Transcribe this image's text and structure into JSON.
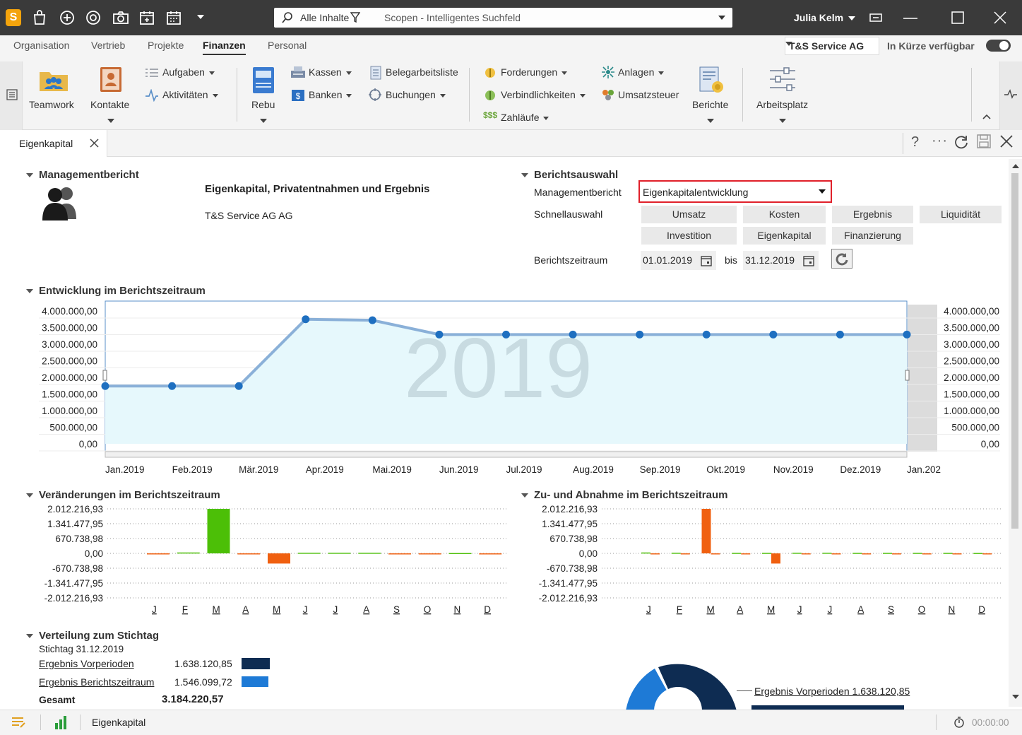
{
  "titlebar": {
    "search_scope": "Alle Inhalte",
    "search_placeholder": "Scopen - Intelligentes Suchfeld",
    "user": "Julia Kelm"
  },
  "menu": {
    "tabs": [
      "Organisation",
      "Vertrieb",
      "Projekte",
      "Finanzen",
      "Personal"
    ],
    "active": "Finanzen",
    "company": "T&S Service AG",
    "availability": "In Kürze verfügbar"
  },
  "ribbon": {
    "teamwork": "Teamwork",
    "kontakte": "Kontakte",
    "aufgaben": "Aufgaben",
    "aktivitaeten": "Aktivitäten",
    "rebu": "Rebu",
    "kassen": "Kassen",
    "banken": "Banken",
    "belegarbeitsliste": "Belegarbeitsliste",
    "buchungen": "Buchungen",
    "forderungen": "Forderungen",
    "verbindlichkeiten": "Verbindlichkeiten",
    "zahllaeufe": "Zahläufe",
    "anlagen": "Anlagen",
    "umsatzsteuer": "Umsatzsteuer",
    "berichte": "Berichte",
    "arbeitsplatz": "Arbeitsplatz"
  },
  "doc_tab": "Eigenkapital",
  "mgmt": {
    "section": "Managementbericht",
    "title": "Eigenkapital, Privatentnahmen und Ergebnis",
    "company": "T&S Service AG AG"
  },
  "auswahl": {
    "section": "Berichtsauswahl",
    "report_label": "Managementbericht",
    "report_value": "Eigenkapitalentwicklung",
    "quick_label": "Schnellauswahl",
    "quick": [
      "Umsatz",
      "Kosten",
      "Ergebnis",
      "Liquidität",
      "Investition",
      "Eigenkapital",
      "Finanzierung"
    ],
    "period_label": "Berichtszeitraum",
    "from": "01.01.2019",
    "bis": "bis",
    "to": "31.12.2019"
  },
  "entwicklung": {
    "section": "Entwicklung im Berichtszeitraum",
    "watermark": "2019"
  },
  "chart_data": [
    {
      "type": "area",
      "x": [
        "Jan.2019",
        "Feb.2019",
        "Mär.2019",
        "Apr.2019",
        "Mai.2019",
        "Jun.2019",
        "Jul.2019",
        "Aug.2019",
        "Sep.2019",
        "Okt.2019",
        "Nov.2019",
        "Dez.2019",
        "Jan.202"
      ],
      "values": [
        1740000,
        1740000,
        1740000,
        3750000,
        3720000,
        3290000,
        3290000,
        3290000,
        3290000,
        3290000,
        3290000,
        3290000,
        3290000
      ],
      "ylim": [
        0,
        4000000
      ],
      "yticks": [
        "4.000.000,00",
        "3.500.000,00",
        "3.000.000,00",
        "2.500.000,00",
        "2.000.000,00",
        "1.500.000,00",
        "1.000.000,00",
        "500.000,00",
        "0,00"
      ]
    },
    {
      "type": "bar",
      "title": "Veränderungen im Berichtszeitraum",
      "categories": [
        "J",
        "F",
        "M",
        "A",
        "M",
        "J",
        "J",
        "A",
        "S",
        "O",
        "N",
        "D"
      ],
      "values": [
        -20000,
        40000,
        2012216.93,
        -20000,
        -460000,
        30000,
        30000,
        30000,
        -15000,
        -15000,
        15000,
        -15000
      ],
      "ylim": [
        -2012216.93,
        2012216.93
      ],
      "yticks": [
        "2.012.216,93",
        "1.341.477,95",
        "670.738,98",
        "0,00",
        "-670.738,98",
        "-1.341.477,95",
        "-2.012.216,93"
      ]
    },
    {
      "type": "bar",
      "title": "Zu- und Abnahme im Berichtszeitraum",
      "categories": [
        "J",
        "F",
        "M",
        "A",
        "M",
        "J",
        "J",
        "A",
        "S",
        "O",
        "N",
        "D"
      ],
      "series": [
        {
          "values": [
            40000,
            30000,
            2012216.93,
            25000,
            25000,
            30000,
            30000,
            25000,
            25000,
            25000,
            25000,
            20000
          ]
        },
        {
          "values": [
            -20000,
            -10000,
            0,
            -20000,
            -460000,
            -15000,
            -15000,
            -15000,
            -15000,
            -15000,
            -15000,
            -15000
          ]
        }
      ],
      "ylim": [
        -2012216.93,
        2012216.93
      ],
      "yticks": [
        "2.012.216,93",
        "1.341.477,95",
        "670.738,98",
        "0,00",
        "-670.738,98",
        "-1.341.477,95",
        "-2.012.216,93"
      ]
    },
    {
      "type": "pie",
      "categories": [
        "Ergebnis Vorperioden",
        "Ergebnis Berichtszeitraum"
      ],
      "values": [
        1638120.85,
        1546099.72
      ]
    }
  ],
  "changes": {
    "section": "Veränderungen im Berichtszeitraum"
  },
  "zuab": {
    "section": "Zu- und Abnahme im Berichtszeitraum"
  },
  "verteilung": {
    "section": "Verteilung zum Stichtag",
    "stichtag": "Stichtag 31.12.2019",
    "rows": [
      {
        "label": "Ergebnis Vorperioden",
        "value": "1.638.120,85"
      },
      {
        "label": "Ergebnis Berichtszeitraum",
        "value": "1.546.099,72"
      }
    ],
    "total_label": "Gesamt",
    "total_value": "3.184.220,57",
    "pie_legend": "Ergebnis Vorperioden 1.638.120,85"
  },
  "status": {
    "tab": "Eigenkapital",
    "timer": "00:00:00"
  },
  "colors": {
    "accent_red": "#e0202a",
    "line": "#8ab0d8",
    "area": "#e6f8fc",
    "point": "#1e6fc0",
    "green": "#4cbf07",
    "orange": "#f06010",
    "dark_navy": "#0e2c52",
    "blue": "#1e7ad6"
  }
}
